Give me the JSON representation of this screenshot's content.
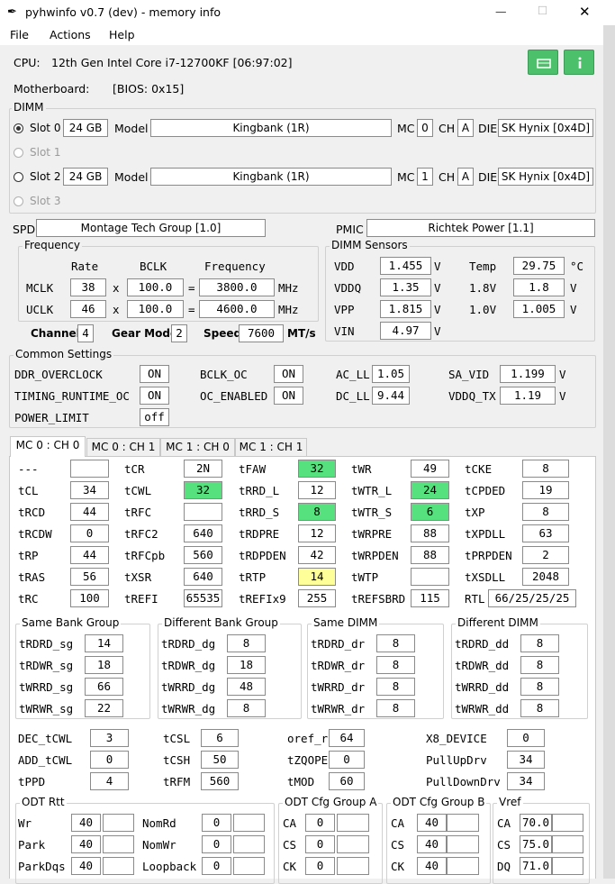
{
  "window": {
    "title": "pyhwinfo v0.7 (dev) - memory info",
    "minimize": "—",
    "maximize": "☐",
    "close": "✕"
  },
  "menu": {
    "file": "File",
    "actions": "Actions",
    "help": "Help"
  },
  "cpu": {
    "label": "CPU:",
    "value": "12th Gen Intel Core i7-12700KF  [06:97:02]"
  },
  "motherboard": {
    "label": "Motherboard:",
    "value": "[BIOS: 0x15]"
  },
  "dimm": {
    "title": "DIMM",
    "model_label": "Model",
    "mc_label": "MC",
    "ch_label": "CH",
    "die_label": "DIE",
    "slots": [
      {
        "label": "Slot 0",
        "size": "24 GB",
        "model": "Kingbank    (1R)",
        "mc": "0",
        "ch": "A",
        "die": "SK Hynix [0x4D]"
      },
      {
        "label": "Slot 1"
      },
      {
        "label": "Slot 2",
        "size": "24 GB",
        "model": "Kingbank    (1R)",
        "mc": "1",
        "ch": "A",
        "die": "SK Hynix [0x4D]"
      },
      {
        "label": "Slot 3"
      }
    ]
  },
  "spd": {
    "label": "SPD",
    "value": "Montage Tech Group [1.0]"
  },
  "pmic": {
    "label": "PMIC",
    "value": "Richtek Power [1.1]"
  },
  "frequency": {
    "title": "Frequency",
    "rate": "Rate",
    "bclk": "BCLK",
    "freq": "Frequency",
    "x": "x",
    "eq": "=",
    "mhz": "MHz",
    "mclk": {
      "label": "MCLK",
      "rate": "38",
      "bclk": "100.0",
      "freq": "3800.0"
    },
    "uclk": {
      "label": "UCLK",
      "rate": "46",
      "bclk": "100.0",
      "freq": "4600.0"
    },
    "channels_label": "Channels",
    "channels": "4",
    "gear_label": "Gear Mode",
    "gear": "2",
    "speed_label": "Speed",
    "speed": "7600",
    "speed_unit": "MT/s"
  },
  "sensors": {
    "title": "DIMM Sensors",
    "vdd": {
      "label": "VDD",
      "value": "1.455",
      "unit": "V"
    },
    "vddq": {
      "label": "VDDQ",
      "value": "1.35",
      "unit": "V"
    },
    "vpp": {
      "label": "VPP",
      "value": "1.815",
      "unit": "V"
    },
    "vin": {
      "label": "VIN",
      "value": "4.97",
      "unit": "V"
    },
    "temp": {
      "label": "Temp",
      "value": "29.75",
      "unit": "°C"
    },
    "v18": {
      "label": "1.8V",
      "value": "1.8",
      "unit": "V"
    },
    "v10": {
      "label": "1.0V",
      "value": "1.005",
      "unit": "V"
    }
  },
  "common": {
    "title": "Common Settings",
    "ddr_oc": {
      "label": "DDR_OVERCLOCK",
      "value": "ON"
    },
    "timing_rt": {
      "label": "TIMING_RUNTIME_OC",
      "value": "ON"
    },
    "power_limit": {
      "label": "POWER_LIMIT",
      "value": "off"
    },
    "bclk_oc": {
      "label": "BCLK_OC",
      "value": "ON"
    },
    "oc_enabled": {
      "label": "OC_ENABLED",
      "value": "ON"
    },
    "ac_ll": {
      "label": "AC_LL",
      "value": "1.05"
    },
    "dc_ll": {
      "label": "DC_LL",
      "value": "9.44"
    },
    "sa_vid": {
      "label": "SA_VID",
      "value": "1.199",
      "unit": "V"
    },
    "vddq_tx": {
      "label": "VDDQ_TX",
      "value": "1.19",
      "unit": "V"
    }
  },
  "tabs": [
    "MC 0 : CH 0",
    "MC 0 : CH 1",
    "MC 1 : CH 0",
    "MC 1 : CH 1"
  ],
  "timings": [
    [
      [
        "---",
        ""
      ],
      [
        "tCR",
        "2N"
      ],
      [
        "tFAW",
        "32"
      ],
      [
        "tWR",
        "49"
      ],
      [
        "tCKE",
        "8"
      ]
    ],
    [
      [
        "tCL",
        "34"
      ],
      [
        "tCWL",
        "32"
      ],
      [
        "tRRD_L",
        "12"
      ],
      [
        "tWTR_L",
        "24"
      ],
      [
        "tCPDED",
        "19"
      ]
    ],
    [
      [
        "tRCD",
        "44"
      ],
      [
        "tRFC",
        ""
      ],
      [
        "tRRD_S",
        "8"
      ],
      [
        "tWTR_S",
        "6"
      ],
      [
        "tXP",
        "8"
      ]
    ],
    [
      [
        "tRCDW",
        "0"
      ],
      [
        "tRFC2",
        "640"
      ],
      [
        "tRDPRE",
        "12"
      ],
      [
        "tWRPRE",
        "88"
      ],
      [
        "tXPDLL",
        "63"
      ]
    ],
    [
      [
        "tRP",
        "44"
      ],
      [
        "tRFCpb",
        "560"
      ],
      [
        "tRDPDEN",
        "42"
      ],
      [
        "tWRPDEN",
        "88"
      ],
      [
        "tPRPDEN",
        "2"
      ]
    ],
    [
      [
        "tRAS",
        "56"
      ],
      [
        "tXSR",
        "640"
      ],
      [
        "tRTP",
        "14"
      ],
      [
        "tWTP",
        ""
      ],
      [
        "tXSDLL",
        "2048"
      ]
    ],
    [
      [
        "tRC",
        "100"
      ],
      [
        "tREFI",
        "65535"
      ],
      [
        "tREFIx9",
        "255"
      ],
      [
        "tREFSBRD",
        "115"
      ],
      [
        "RTL",
        "66/25/25/25"
      ]
    ]
  ],
  "groups": [
    {
      "title": "Same Bank Group",
      "rows": [
        [
          "tRDRD_sg",
          "14"
        ],
        [
          "tRDWR_sg",
          "18"
        ],
        [
          "tWRRD_sg",
          "66"
        ],
        [
          "tWRWR_sg",
          "22"
        ]
      ]
    },
    {
      "title": "Different Bank Group",
      "rows": [
        [
          "tRDRD_dg",
          "8"
        ],
        [
          "tRDWR_dg",
          "18"
        ],
        [
          "tWRRD_dg",
          "48"
        ],
        [
          "tWRWR_dg",
          "8"
        ]
      ]
    },
    {
      "title": "Same DIMM",
      "rows": [
        [
          "tRDRD_dr",
          "8"
        ],
        [
          "tRDWR_dr",
          "8"
        ],
        [
          "tWRRD_dr",
          "8"
        ],
        [
          "tWRWR_dr",
          "8"
        ]
      ]
    },
    {
      "title": "Different DIMM",
      "rows": [
        [
          "tRDRD_dd",
          "8"
        ],
        [
          "tRDWR_dd",
          "8"
        ],
        [
          "tWRRD_dd",
          "8"
        ],
        [
          "tWRWR_dd",
          "8"
        ]
      ]
    }
  ],
  "misc": [
    [
      [
        "DEC_tCWL",
        "3"
      ],
      [
        "tCSL",
        "6"
      ],
      [
        "oref_ri",
        "64"
      ],
      [
        "X8_DEVICE",
        "0"
      ]
    ],
    [
      [
        "ADD_tCWL",
        "0"
      ],
      [
        "tCSH",
        "50"
      ],
      [
        "tZQOPER",
        "0"
      ],
      [
        "PullUpDrv",
        "34"
      ]
    ],
    [
      [
        "tPPD",
        "4"
      ],
      [
        "tRFM",
        "560"
      ],
      [
        "tMOD",
        "60"
      ],
      [
        "PullDownDrv",
        "34"
      ]
    ]
  ],
  "odt_rtt": {
    "title": "ODT Rtt",
    "rows": [
      [
        "Wr",
        "40",
        "NomRd",
        "0"
      ],
      [
        "Park",
        "40",
        "NomWr",
        "0"
      ],
      [
        "ParkDqs",
        "40",
        "Loopback",
        "0"
      ]
    ]
  },
  "odt_a": {
    "title": "ODT Cfg Group A",
    "rows": [
      [
        "CA",
        "0"
      ],
      [
        "CS",
        "0"
      ],
      [
        "CK",
        "0"
      ]
    ]
  },
  "odt_b": {
    "title": "ODT Cfg Group B",
    "rows": [
      [
        "CA",
        "40"
      ],
      [
        "CS",
        "40"
      ],
      [
        "CK",
        "40"
      ]
    ]
  },
  "vref": {
    "title": "Vref",
    "rows": [
      [
        "CA",
        "70.0"
      ],
      [
        "CS",
        "75.0"
      ],
      [
        "DQ",
        "71.0"
      ]
    ]
  },
  "highlight": {
    "green": "#56e07e",
    "yellow": "#ffff9a"
  }
}
